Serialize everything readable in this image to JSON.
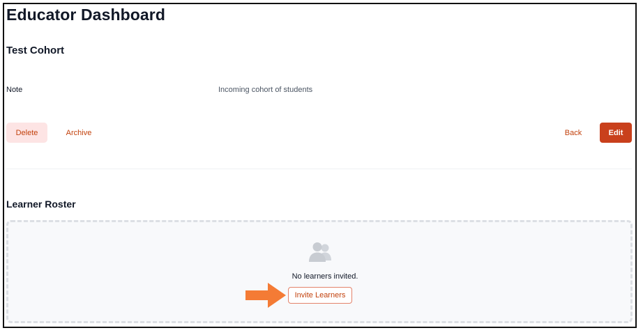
{
  "page": {
    "title": "Educator Dashboard"
  },
  "cohort": {
    "name": "Test Cohort",
    "note_label": "Note",
    "note_value": "Incoming cohort of students"
  },
  "actions": {
    "delete_label": "Delete",
    "archive_label": "Archive",
    "back_label": "Back",
    "edit_label": "Edit"
  },
  "roster": {
    "title": "Learner Roster",
    "empty_icon": "users-icon",
    "empty_text": "No learners invited.",
    "invite_label": "Invite Learners"
  },
  "annotation": {
    "arrow_icon": "arrow-right-icon",
    "arrow_color": "#f47b35"
  },
  "colors": {
    "accent": "#c2410c",
    "edit_button": "#c9401c",
    "delete_bg": "#fde4e4"
  }
}
